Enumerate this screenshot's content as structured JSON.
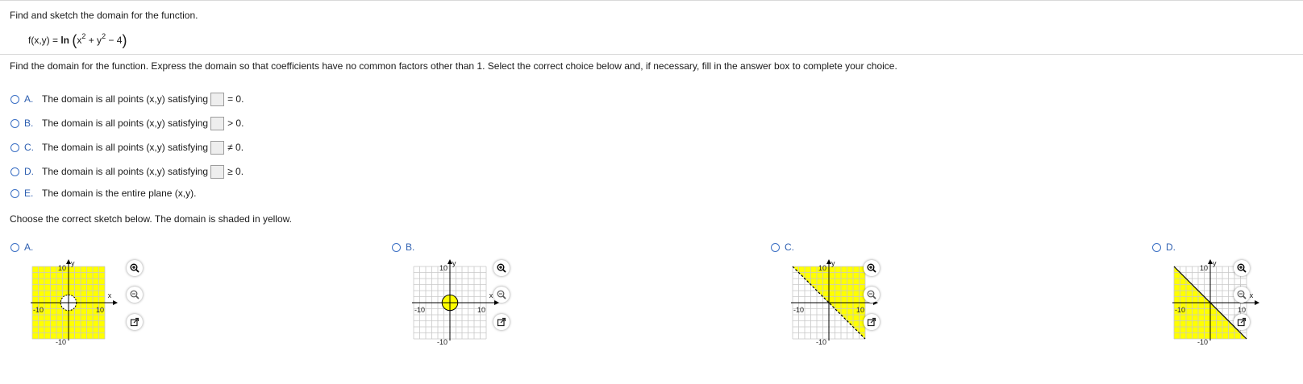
{
  "question": {
    "title": "Find and sketch the domain for the function.",
    "function_lhs": "f(x,y) = ",
    "function_ln": "ln",
    "function_x": "x",
    "function_exp1": "2",
    "function_plus": " + y",
    "function_exp2": "2",
    "function_minus": " − 4",
    "instructions": "Find the domain for the function. Express the domain so that coefficients have no common factors other than 1. Select the correct choice below and, if necessary, fill in the answer box to complete your choice."
  },
  "domain_choices": [
    {
      "letter": "A.",
      "text": "The domain is all points (x,y) satisfying",
      "relation": "= 0."
    },
    {
      "letter": "B.",
      "text": "The domain is all points (x,y) satisfying",
      "relation": "> 0."
    },
    {
      "letter": "C.",
      "text": "The domain is all points (x,y) satisfying",
      "relation": "≠ 0."
    },
    {
      "letter": "D.",
      "text": "The domain is all points (x,y) satisfying",
      "relation": "≥ 0."
    },
    {
      "letter": "E.",
      "text": "The domain is the entire plane (x,y).",
      "relation": ""
    }
  ],
  "sketch_prompt": "Choose the correct sketch below. The domain is shaded in yellow.",
  "graph_choices": [
    {
      "letter": "A.",
      "shading": "outside-circle-open"
    },
    {
      "letter": "B.",
      "shading": "inside-circle-closed"
    },
    {
      "letter": "C.",
      "shading": "above-line-dashed"
    },
    {
      "letter": "D.",
      "shading": "below-line-solid"
    }
  ],
  "graph_labels": {
    "tick_pos": "10",
    "tick_neg": "-10",
    "x_axis": "x",
    "y_axis": "y"
  },
  "colors": {
    "shade": "#ffff00",
    "grid": "#c8c8c8",
    "accent": "#2e5fb0"
  },
  "icons": {
    "zoom_in": "zoom-in-icon",
    "zoom_out": "zoom-out-icon",
    "popout": "external-link-icon"
  }
}
